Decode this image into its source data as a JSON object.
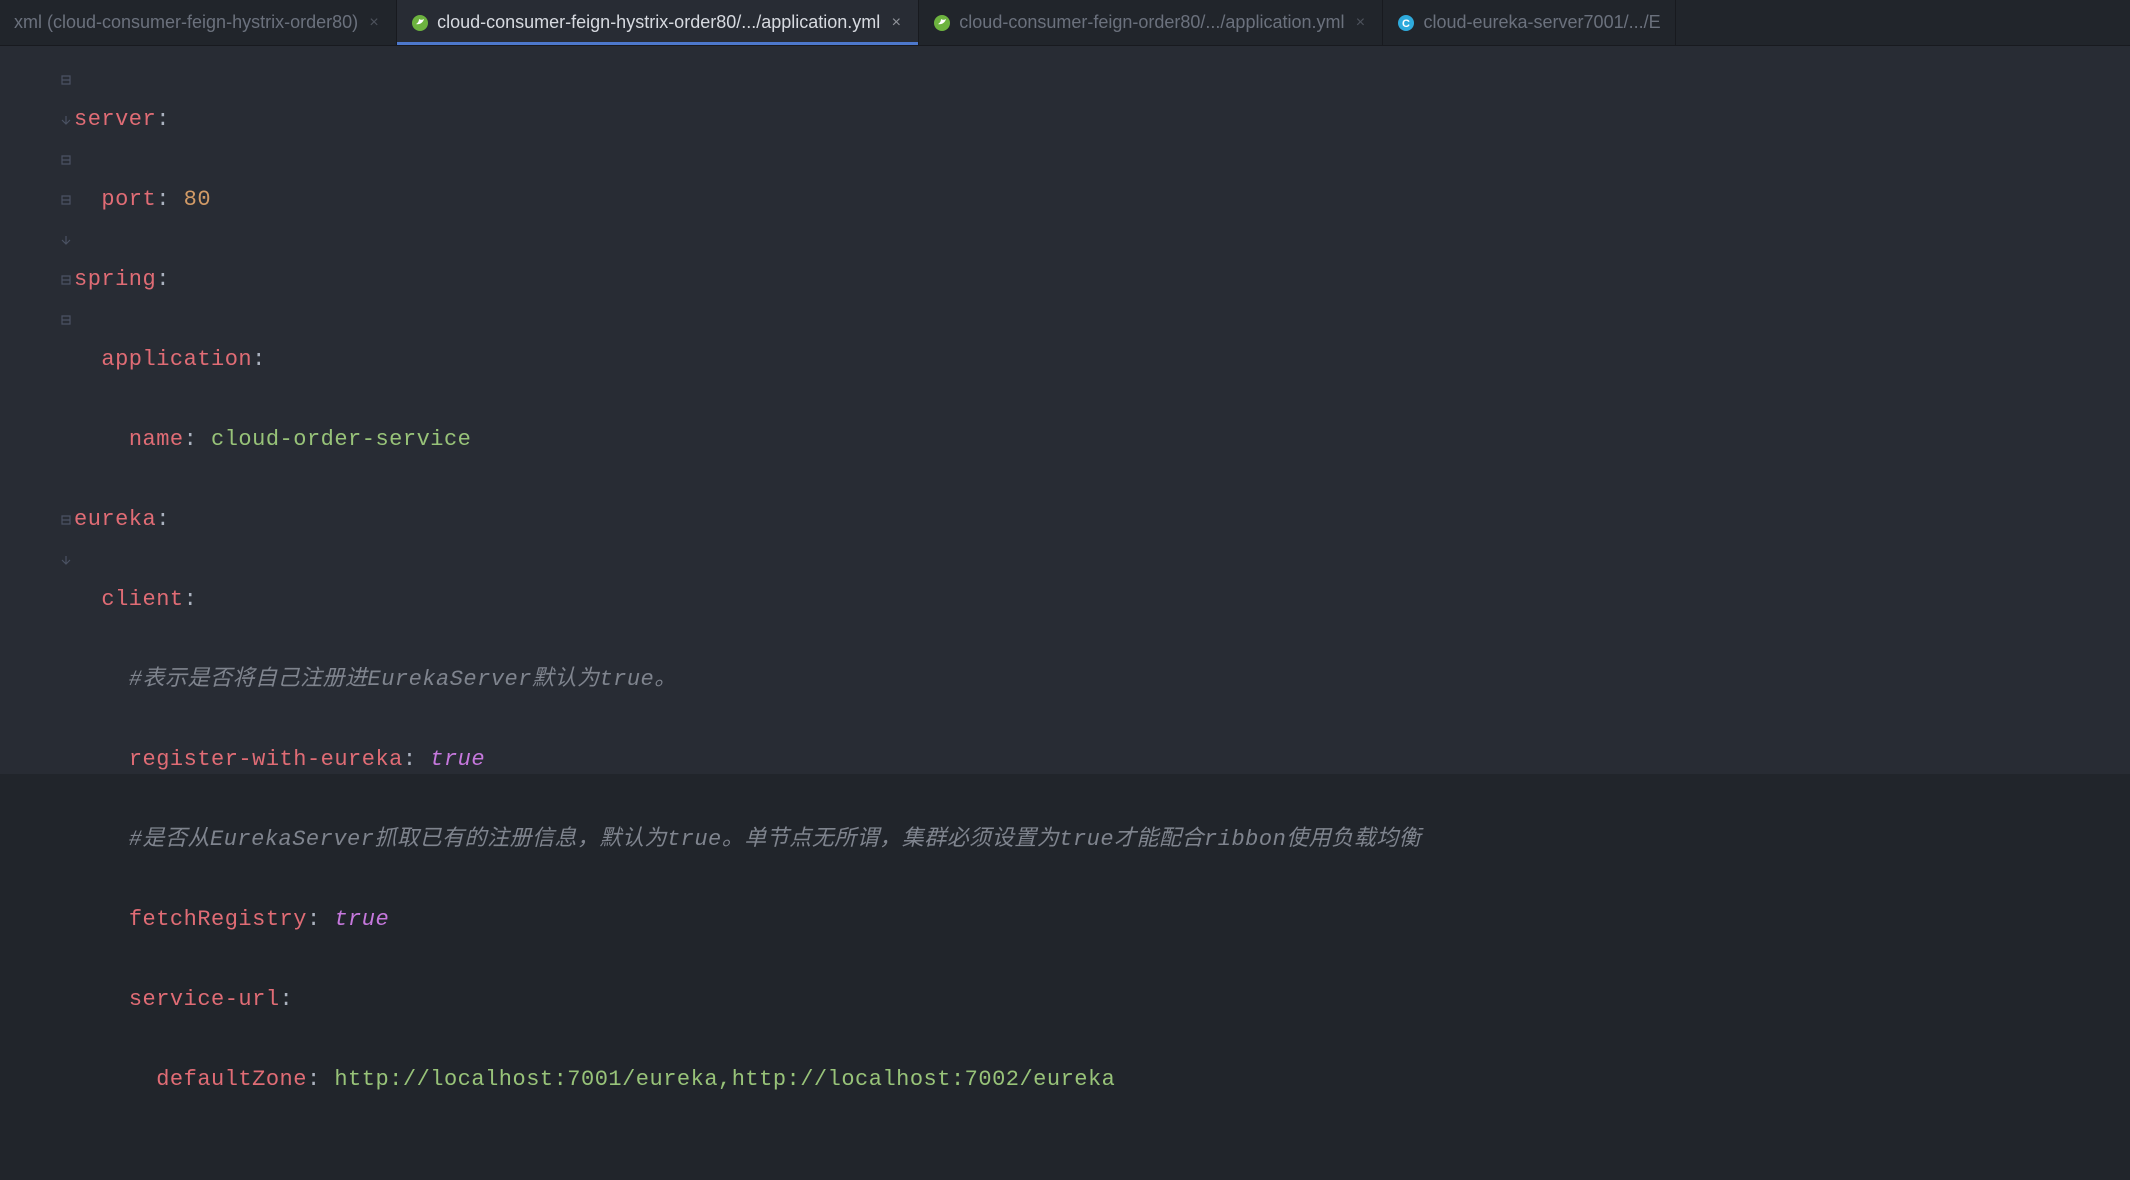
{
  "tabs": [
    {
      "label": "xml (cloud-consumer-feign-hystrix-order80)",
      "icon": "xml",
      "active": false
    },
    {
      "label": "cloud-consumer-feign-hystrix-order80/.../application.yml",
      "icon": "spring",
      "active": true
    },
    {
      "label": "cloud-consumer-feign-order80/.../application.yml",
      "icon": "spring",
      "active": false
    },
    {
      "label": "cloud-eureka-server7001/.../E",
      "icon": "class",
      "active": false
    }
  ],
  "code": {
    "l1_key": "server",
    "l1_colon": ":",
    "l2_key": "port",
    "l2_colon": ": ",
    "l2_val": "80",
    "l3_key": "spring",
    "l3_colon": ":",
    "l4_key": "application",
    "l4_colon": ":",
    "l5_key": "name",
    "l5_colon": ": ",
    "l5_val": "cloud-order-service",
    "l6_key": "eureka",
    "l6_colon": ":",
    "l7_key": "client",
    "l7_colon": ":",
    "l8_comment": "#表示是否将自己注册进EurekaServer默认为true。",
    "l9_key": "register-with-eureka",
    "l9_colon": ": ",
    "l9_val": "true",
    "l10_comment": "#是否从EurekaServer抓取已有的注册信息，默认为true。单节点无所谓，集群必须设置为true才能配合ribbon使用负载均衡",
    "l11_key": "fetchRegistry",
    "l11_colon": ": ",
    "l11_val": "true",
    "l12_key": "service-url",
    "l12_colon": ":",
    "l13_key": "defaultZone",
    "l13_colon": ": ",
    "l13_val": "http://localhost:7001/eureka,http://localhost:7002/eureka"
  }
}
